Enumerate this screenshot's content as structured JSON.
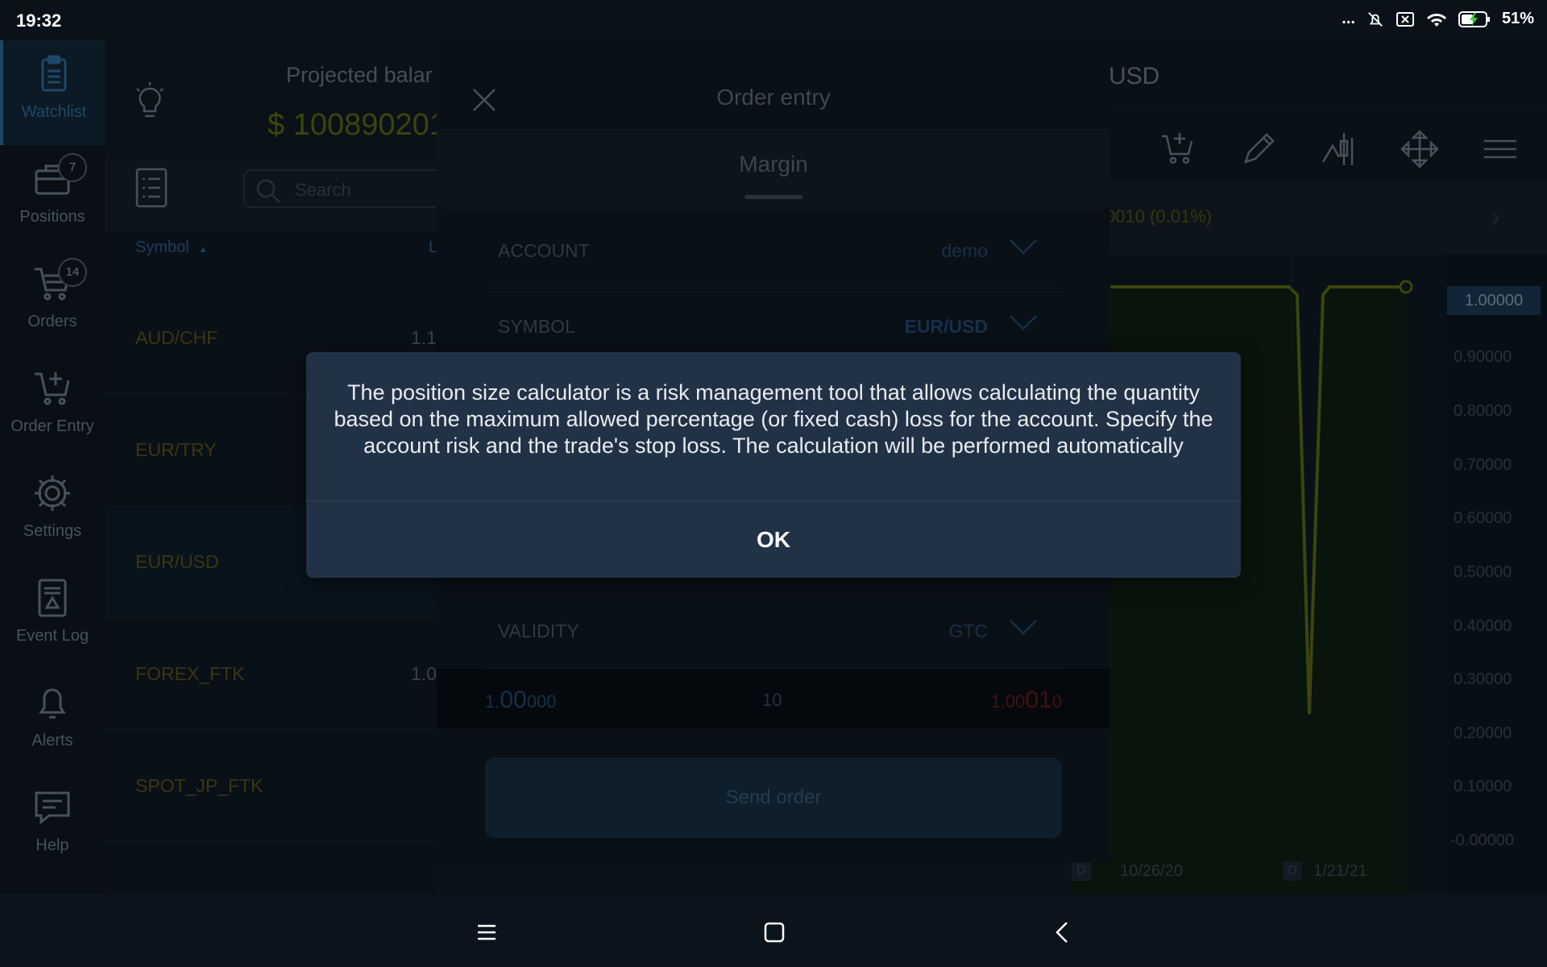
{
  "status_bar": {
    "time": "19:32",
    "dots": "...",
    "battery_percent": "51%"
  },
  "nav": [
    {
      "label": "Watchlist",
      "icon": "clipboard-icon",
      "active": true
    },
    {
      "label": "Positions",
      "icon": "briefcase-icon",
      "badge": "7"
    },
    {
      "label": "Orders",
      "icon": "cart-icon",
      "badge": "14"
    },
    {
      "label": "Order Entry",
      "icon": "cart-add-icon"
    },
    {
      "label": "Settings",
      "icon": "gear-icon"
    },
    {
      "label": "Event Log",
      "icon": "event-log-icon"
    },
    {
      "label": "Alerts",
      "icon": "bell-icon"
    },
    {
      "label": "Help",
      "icon": "help-chat-icon"
    }
  ],
  "watchlist": {
    "projected_label": "Projected balar",
    "projected_value": "$ 100890201",
    "search_placeholder": "Search",
    "symbol_header": "Symbol",
    "col2_header": "L",
    "rows": [
      {
        "symbol": "AUD/CHF",
        "value": "1.1"
      },
      {
        "symbol": "EUR/TRY",
        "value": ""
      },
      {
        "symbol": "EUR/USD",
        "value": ""
      },
      {
        "symbol": "FOREX_FTK",
        "value": "1.0"
      },
      {
        "symbol": "SPOT_JP_FTK",
        "value": ""
      }
    ]
  },
  "chart": {
    "title": "USD",
    "change": "0010 (0.01%)",
    "current_price": "1.00000",
    "y_ticks": [
      "0.90000",
      "0.80000",
      "0.70000",
      "0.60000",
      "0.50000",
      "0.40000",
      "0.30000",
      "0.20000",
      "0.10000",
      "-0.00000"
    ],
    "dates": [
      "10/26/20",
      "1/21/21"
    ],
    "date_marker": "D"
  },
  "order_entry": {
    "title": "Order entry",
    "tab": "Margin",
    "account_label": "ACCOUNT",
    "account_value": "demo",
    "symbol_label": "SYMBOL",
    "symbol_value": "EUR/USD",
    "validity_label": "VALIDITY",
    "validity_value": "GTC",
    "bid": {
      "pre": "1.",
      "big": "00",
      "post": "000"
    },
    "quantity": "10",
    "ask": {
      "pre": "1.00",
      "big": "01",
      "post": "0"
    },
    "send_label": "Send order"
  },
  "alert": {
    "message": "The position size calculator is a risk management tool that allows calculating the quantity based on the maximum allowed percentage (or fixed cash) loss for the account. Specify the account risk and the trade's stop loss. The calculation will be performed automatically",
    "ok_label": "OK"
  },
  "colors": {
    "accent": "#2d6f9d",
    "symbol_text": "#5c5217",
    "bid": "#214a6f",
    "ask": "#8a2020",
    "line": "#5c6a15"
  }
}
